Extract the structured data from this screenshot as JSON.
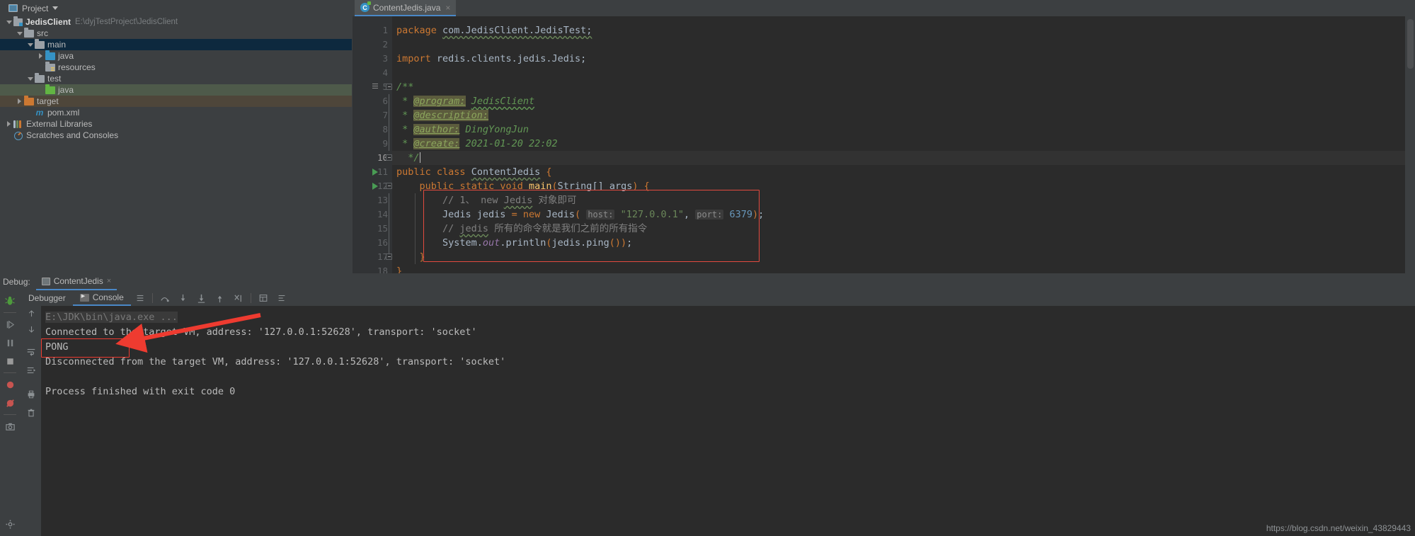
{
  "topbar": {
    "project_label": "Project",
    "icons": [
      "locate-icon",
      "collapse-all-icon",
      "settings-gear-icon",
      "minimize-icon"
    ]
  },
  "editor_tab": {
    "label": "ContentJedis.java",
    "close": "×"
  },
  "project_tree": [
    {
      "name": "JedisClient",
      "path": "E:\\dyjTestProject\\JedisClient",
      "icon": "project-icon",
      "arrow": "down",
      "indent": 0,
      "bold": true,
      "highlight": "none"
    },
    {
      "name": "src",
      "path": "",
      "icon": "folder-gray",
      "arrow": "down",
      "indent": 1,
      "bold": false,
      "highlight": "none"
    },
    {
      "name": "main",
      "path": "",
      "icon": "folder-gray",
      "arrow": "down",
      "indent": 2,
      "bold": false,
      "highlight": "blue"
    },
    {
      "name": "java",
      "path": "",
      "icon": "folder-blue",
      "arrow": "right",
      "indent": 3,
      "bold": false,
      "highlight": "none"
    },
    {
      "name": "resources",
      "path": "",
      "icon": "folder-resources",
      "arrow": "none",
      "indent": 3,
      "bold": false,
      "highlight": "none"
    },
    {
      "name": "test",
      "path": "",
      "icon": "folder-gray",
      "arrow": "down",
      "indent": 2,
      "bold": false,
      "highlight": "none"
    },
    {
      "name": "java",
      "path": "",
      "icon": "folder-green",
      "arrow": "none",
      "indent": 3,
      "bold": false,
      "highlight": "green"
    },
    {
      "name": "target",
      "path": "",
      "icon": "folder-orange",
      "arrow": "right",
      "indent": 1,
      "bold": false,
      "highlight": "brown"
    },
    {
      "name": "pom.xml",
      "path": "",
      "icon": "maven-icon",
      "arrow": "none",
      "indent": 2,
      "bold": false,
      "highlight": "none"
    },
    {
      "name": "External Libraries",
      "path": "",
      "icon": "libraries-icon",
      "arrow": "right",
      "indent": 0,
      "bold": false,
      "highlight": "none"
    },
    {
      "name": "Scratches and Consoles",
      "path": "",
      "icon": "scratches-icon",
      "arrow": "none",
      "indent": 0,
      "bold": false,
      "highlight": "none"
    }
  ],
  "code": {
    "lines": [
      {
        "n": 1,
        "text": "package com.JedisClient.JedisTest;"
      },
      {
        "n": 2,
        "text": ""
      },
      {
        "n": 3,
        "text": "import redis.clients.jedis.Jedis;"
      },
      {
        "n": 4,
        "text": ""
      },
      {
        "n": 5,
        "text": "/**"
      },
      {
        "n": 6,
        "text": " * @program: JedisClient"
      },
      {
        "n": 7,
        "text": " * @description:"
      },
      {
        "n": 8,
        "text": " * @author: DingYongJun"
      },
      {
        "n": 9,
        "text": " * @create: 2021-01-20 22:02"
      },
      {
        "n": 10,
        "text": " */"
      },
      {
        "n": 11,
        "text": "public class ContentJedis {"
      },
      {
        "n": 12,
        "text": "    public static void main(String[] args) {"
      },
      {
        "n": 13,
        "text": "        // 1、 new Jedis 对象即可"
      },
      {
        "n": 14,
        "text": "        Jedis jedis = new Jedis( host: \"127.0.0.1\", port: 6379);"
      },
      {
        "n": 15,
        "text": "        // jedis 所有的命令就是我们之前的所有指令"
      },
      {
        "n": 16,
        "text": "        System.out.println(jedis.ping());"
      },
      {
        "n": 17,
        "text": "    }"
      },
      {
        "n": 18,
        "text": "}"
      }
    ],
    "tokens": {
      "kw_package": "package",
      "pkg_name": "com.JedisClient.JedisTest;",
      "kw_import": "import",
      "import_name": "redis.clients.jedis.Jedis;",
      "doc_open": "/**",
      "doc_close": " */",
      "tag_program": "@program:",
      "val_program": "JedisClient",
      "tag_description": "@description:",
      "tag_author": "@author:",
      "val_author": "DingYongJun",
      "tag_create": "@create:",
      "val_create": "2021-01-20 22:02",
      "kw_public": "public",
      "kw_class": "class",
      "class_name": "ContentJedis",
      "brace_open": "{",
      "kw_static": "static",
      "kw_void": "void",
      "method_main": "main",
      "paren_open": "(",
      "type_string": "String[]",
      "arg_name": "args",
      "paren_close": ")",
      "comment13": "// 1、 new Jedis 对象即可",
      "type_jedis": "Jedis",
      "var_jedis": "jedis",
      "equals": "=",
      "kw_new": "new",
      "hint_host": "host:",
      "str_host": "\"127.0.0.1\"",
      "hint_port": "port:",
      "num_port": "6379",
      "comment15": "// jedis 所有的命令就是我们之前的所有指令",
      "sys": "System",
      "out": "out",
      "println": "println",
      "ping_call": "jedis.ping()",
      "semi": ";",
      "brace_close": "}"
    }
  },
  "debug": {
    "label": "Debug:",
    "tab_label": "ContentJedis",
    "tab_close": "×",
    "subtabs": [
      {
        "label": "Debugger",
        "active": false
      },
      {
        "label": "Console",
        "active": true
      }
    ],
    "toolbar_icons": [
      "layout-icon",
      "step-over-icon",
      "step-into-icon",
      "force-step-into-icon",
      "step-out-icon",
      "run-to-cursor-icon",
      "evaluate-icon",
      "settings2-icon"
    ],
    "left_rail_icons": [
      "debug-bug-icon",
      "resume-icon",
      "pause-icon",
      "stop-icon",
      "view-breakpoints-icon",
      "mute-breakpoints-icon",
      "camera-icon",
      "settings-gear-icon"
    ],
    "inner_rail_icons": [
      "scroll-up-icon",
      "scroll-down-icon",
      "soft-wrap-icon",
      "scroll-to-end-icon",
      "print-icon",
      "clear-all-icon"
    ]
  },
  "console": {
    "lines": [
      {
        "text": "E:\\JDK\\bin\\java.exe ...",
        "style": "dim"
      },
      {
        "text": "Connected to the target VM, address: '127.0.0.1:52628', transport: 'socket'",
        "style": "normal"
      },
      {
        "text": "PONG",
        "style": "normal"
      },
      {
        "text": "Disconnected from the target VM, address: '127.0.0.1:52628', transport: 'socket'",
        "style": "normal"
      },
      {
        "text": "",
        "style": "normal"
      },
      {
        "text": "Process finished with exit code 0",
        "style": "normal"
      }
    ]
  },
  "watermark": "https://blog.csdn.net/weixin_43829443",
  "colors": {
    "accent_blue": "#4a88c7",
    "annotation_red": "#e8392c",
    "keyword_orange": "#cc7832",
    "string_green": "#6a8759",
    "doc_green": "#629755",
    "number_blue": "#6897bb",
    "method_yellow": "#ffc66d"
  }
}
